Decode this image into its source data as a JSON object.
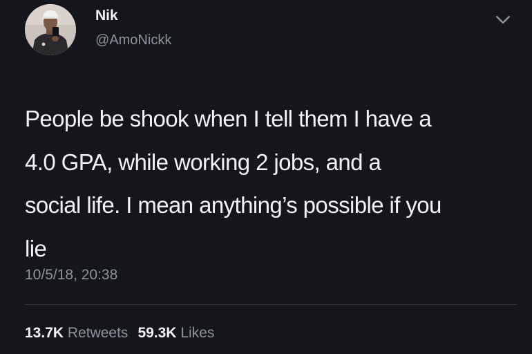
{
  "author": {
    "name": "Nik",
    "handle": "@AmoNickk"
  },
  "tweet": {
    "text_lines": [
      "People be shook when I tell them I have a",
      "4.0 GPA, while working 2 jobs, and a",
      "social life. I mean anything’s possible if you",
      "lie"
    ],
    "timestamp": "10/5/18, 20:38"
  },
  "stats": {
    "retweets_count": "13.7K",
    "retweets_label": "Retweets",
    "likes_count": "59.3K",
    "likes_label": "Likes"
  },
  "colors": {
    "background": "#15161b",
    "primary_text": "#f2f3f5",
    "secondary_text": "#8d939b",
    "divider": "#2d3036"
  },
  "icons": {
    "menu": "chevron-down-icon",
    "avatar": "profile-photo"
  }
}
